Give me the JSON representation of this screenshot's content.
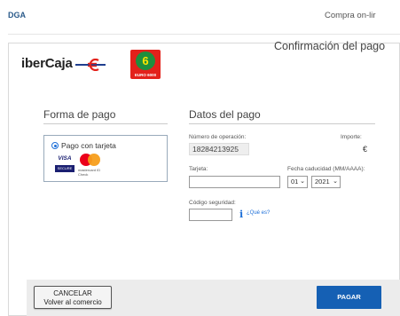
{
  "header": {
    "left_link": "DGA",
    "right_text": "Compra on-lir"
  },
  "logos": {
    "bank_name": "iberCaja",
    "badge_number": "6",
    "badge_sub": "EURO 6000"
  },
  "page_title": "Confirmación del pago",
  "forma_pago": {
    "title": "Forma de pago",
    "option_label": "Pago con tarjeta",
    "visa_label": "VISA",
    "visa_secure_label": "SECURE",
    "mc_label": "mastercard ID Check"
  },
  "datos_pago": {
    "title": "Datos del pago",
    "num_operacion_label": "Número de operación:",
    "num_operacion_value": "18284213925",
    "importe_label": "Importe:",
    "importe_currency": "€",
    "tarjeta_label": "Tarjeta:",
    "tarjeta_value": "",
    "caducidad_label": "Fecha caducidad (MM/AAAA):",
    "month_value": "01",
    "year_value": "2021",
    "codigo_label": "Código seguridad:",
    "codigo_value": "",
    "que_es_link": "¿Qué es?"
  },
  "actions": {
    "cancel_line1": "CANCELAR",
    "cancel_line2": "Volver al comercio",
    "pay_label": "PAGAR"
  },
  "colors": {
    "primary_button": "#1560b4",
    "link": "#1d6fd8",
    "badge_red": "#e3211b"
  }
}
